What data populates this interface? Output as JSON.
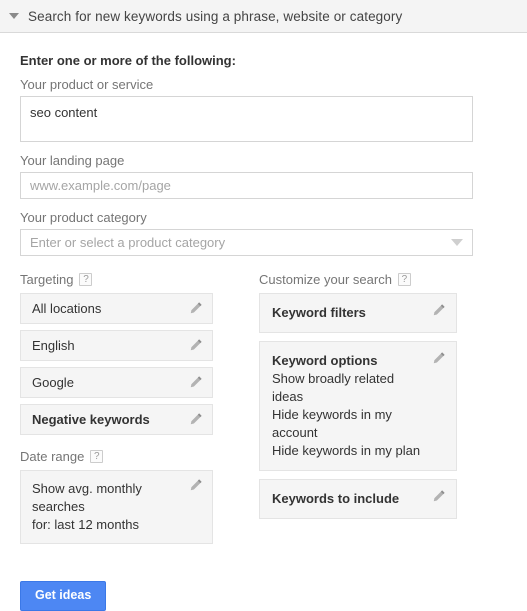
{
  "header": {
    "title": "Search for new keywords using a phrase, website or category",
    "disclosure_state": "expanded"
  },
  "form": {
    "section_title": "Enter one or more of the following:",
    "product_or_service": {
      "label": "Your product or service",
      "value": "seo content",
      "placeholder": ""
    },
    "landing_page": {
      "label": "Your landing page",
      "value": "",
      "placeholder": "www.example.com/page"
    },
    "product_category": {
      "label": "Your product category",
      "value": "",
      "placeholder": "Enter or select a product category"
    }
  },
  "targeting": {
    "heading": "Targeting",
    "help": "?",
    "items": [
      {
        "label": "All locations",
        "bold": false
      },
      {
        "label": "English",
        "bold": false
      },
      {
        "label": "Google",
        "bold": false
      },
      {
        "label": "Negative keywords",
        "bold": true
      }
    ]
  },
  "date_range": {
    "heading": "Date range",
    "help": "?",
    "line1": "Show avg. monthly searches",
    "line2": "for: last 12 months"
  },
  "customize": {
    "heading": "Customize your search",
    "help": "?",
    "keyword_filters": {
      "title": "Keyword filters"
    },
    "keyword_options": {
      "title": "Keyword options",
      "options": [
        "Show broadly related ideas",
        "Hide keywords in my account",
        "Hide keywords in my plan"
      ]
    },
    "keywords_to_include": {
      "title": "Keywords to include"
    }
  },
  "actions": {
    "get_ideas_label": "Get ideas"
  },
  "colors": {
    "accent_blue": "#4d87f3",
    "header_bg": "#f4f4f4",
    "tile_bg": "#f5f5f5",
    "label_gray": "#757575",
    "placeholder_gray": "#a5a5a5"
  }
}
